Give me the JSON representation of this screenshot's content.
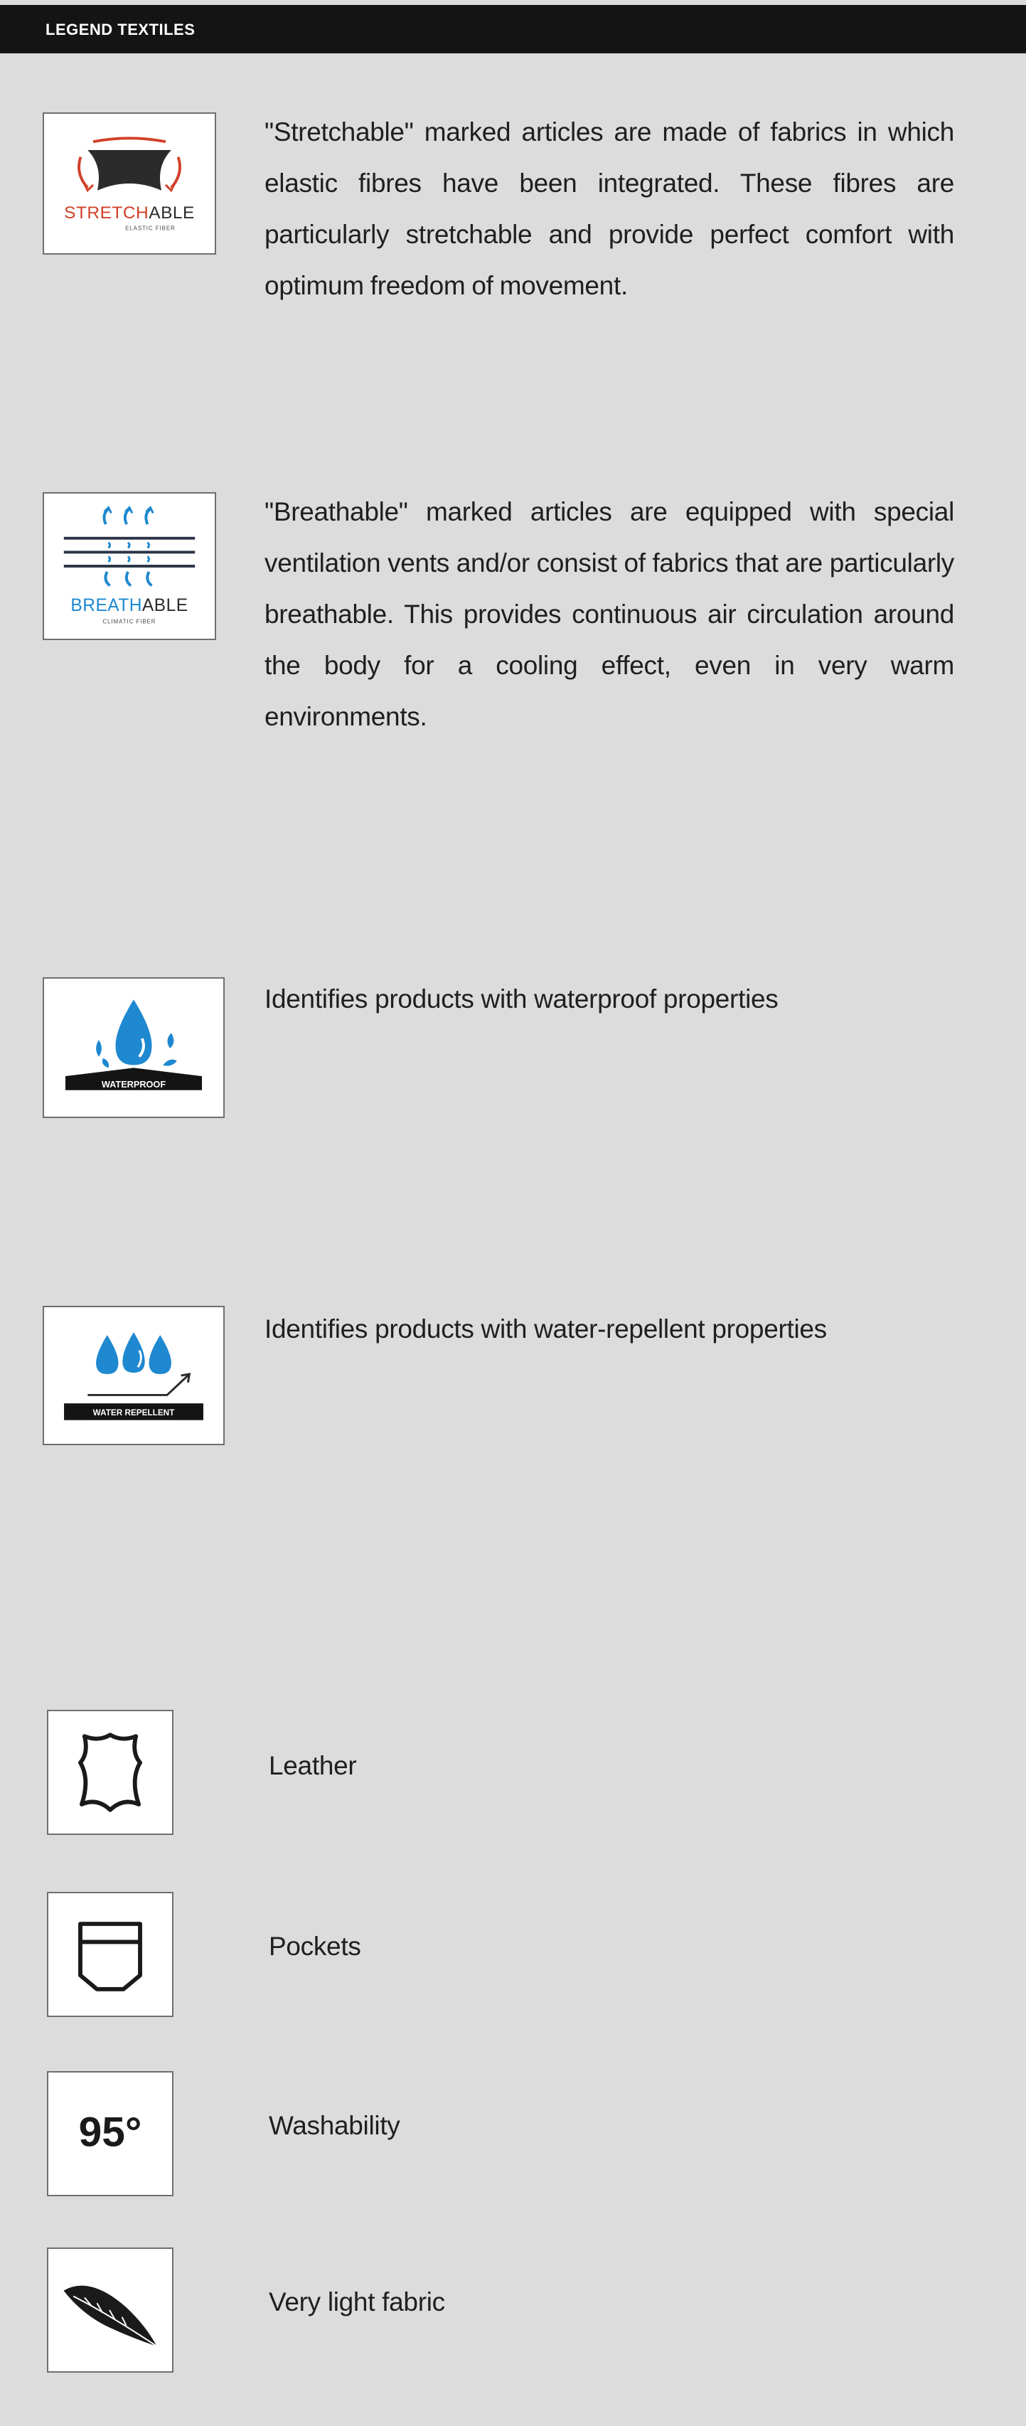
{
  "header": {
    "title": "LEGEND TEXTILES"
  },
  "colors": {
    "background": "#dcdcdc",
    "header_bg": "#141414",
    "accent_red": "#d2402a",
    "water_blue": "#1e88d0",
    "dark_navy": "#2b3447"
  },
  "entries": [
    {
      "icon": "stretchable-icon",
      "badge_main_dark": "STRETCH",
      "badge_main_accent": "ABLE",
      "badge_sub": "ELASTIC FIBER",
      "text": "\"Stretchable\" marked articles are made of fabrics in which elastic fibres have been integrated. These fibres are particularly stretchable and provide perfect comfort with optimum freedom of movement."
    },
    {
      "icon": "breathable-icon",
      "badge_main_dark": "BREATH",
      "badge_main_accent": "ABLE",
      "badge_sub": "CLIMATIC FIBER",
      "text": "\"Breathable\" marked articles are equipped with special ventilation vents and/or consist of fabrics that are particularly breathable. This provides continuous air circulation around the body for a cooling effect, even in very warm environments."
    },
    {
      "icon": "waterproof-icon",
      "badge_label": "WATERPROOF",
      "text": "Identifies products with waterproof properties"
    },
    {
      "icon": "water-repellent-icon",
      "badge_label": "WATER REPELLENT",
      "text": "Identifies products with water-repellent properties"
    }
  ],
  "features": [
    {
      "icon": "leather-icon",
      "label": "Leather"
    },
    {
      "icon": "pocket-icon",
      "label": "Pockets"
    },
    {
      "icon": "washability-icon",
      "icon_text": "95°",
      "label": "Washability"
    },
    {
      "icon": "feather-icon",
      "label": "Very light fabric"
    }
  ]
}
